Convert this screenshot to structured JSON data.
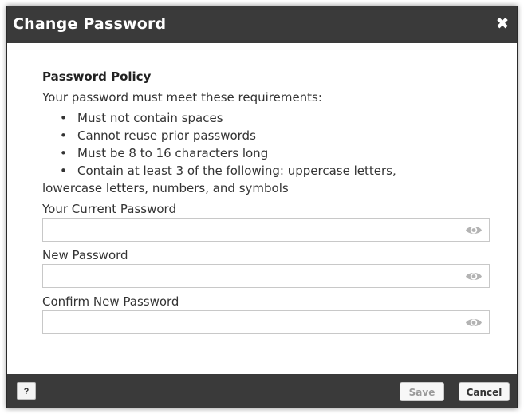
{
  "dialog": {
    "title": "Change Password",
    "close_glyph": "✖"
  },
  "policy": {
    "heading": "Password Policy",
    "intro": "Your password must meet these requirements:",
    "rules": [
      "Must not contain spaces",
      "Cannot reuse prior passwords",
      "Must be 8 to 16 characters long",
      "Contain at least 3 of the following: uppercase letters,",
      "lowercase letters, numbers, and symbols"
    ]
  },
  "fields": {
    "current": {
      "label": "Your Current Password",
      "value": "",
      "icon": "eye-icon"
    },
    "new": {
      "label": "New Password",
      "value": "",
      "icon": "eye-icon"
    },
    "confirm": {
      "label": "Confirm New Password",
      "value": "",
      "icon": "eye-icon"
    }
  },
  "footer": {
    "help_label": "?",
    "save_label": "Save",
    "cancel_label": "Cancel"
  },
  "colors": {
    "titlebar": "#3a3a3a",
    "footer": "#3a3a3a",
    "eye_icon": "#b3b3b3",
    "save_disabled_text": "#9a9a9a"
  }
}
